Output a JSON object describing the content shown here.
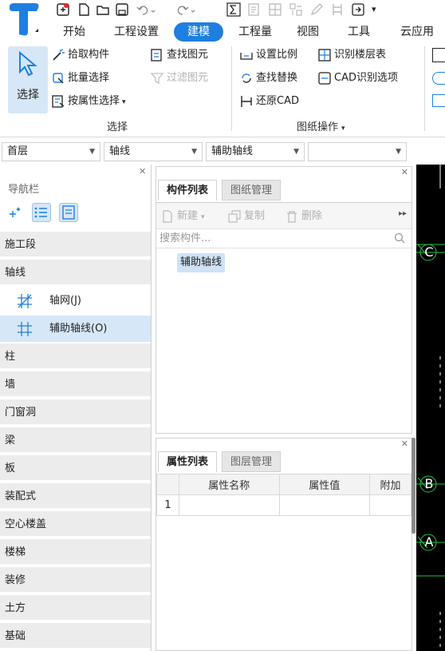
{
  "menu": {
    "tabs": [
      "开始",
      "工程设置",
      "建模",
      "工程量",
      "视图",
      "工具",
      "云应用"
    ],
    "active": "建模"
  },
  "ribbon": {
    "select_label": "选择",
    "pick_component": "拾取构件",
    "batch_select": "批量选择",
    "select_by_property": "按属性选择",
    "find_element": "查找图元",
    "filter_element": "过滤图元",
    "select_group": "选择",
    "set_scale": "设置比例",
    "identify_floor_table": "识别楼层表",
    "find_replace": "查找替换",
    "cad_identify_options": "CAD识别选项",
    "restore_cad": "还原CAD",
    "drawing_ops_group": "图纸操作"
  },
  "combos": {
    "floor": "首层",
    "category": "轴线",
    "type": "辅助轴线",
    "extra": ""
  },
  "nav": {
    "title": "导航栏",
    "categories_top": [
      "施工段",
      "轴线"
    ],
    "sub_items": [
      "轴网(J)",
      "辅助轴线(O)"
    ],
    "selected_sub": "辅助轴线(O)",
    "categories_rest": [
      "柱",
      "墙",
      "门窗洞",
      "梁",
      "板",
      "装配式",
      "空心楼盖",
      "楼梯",
      "装修",
      "土方",
      "基础"
    ]
  },
  "component_panel": {
    "tab_active": "构件列表",
    "tab_inactive": "图纸管理",
    "new_label": "新建",
    "copy_label": "复制",
    "delete_label": "删除",
    "search_placeholder": "搜索构件...",
    "item": "辅助轴线"
  },
  "property_panel": {
    "tab_active": "属性列表",
    "tab_inactive": "图层管理",
    "headers": [
      "属性名称",
      "属性值",
      "附加"
    ],
    "rows": [
      {
        "index": "1",
        "name": "",
        "value": "",
        "extra": ""
      }
    ]
  },
  "canvas": {
    "axis_labels": [
      "C",
      "B",
      "A"
    ]
  },
  "colors": {
    "accent": "#1e7fe0",
    "selection": "#d6e7f8",
    "canvas": "#000000",
    "axis_green": "#22c34a"
  }
}
